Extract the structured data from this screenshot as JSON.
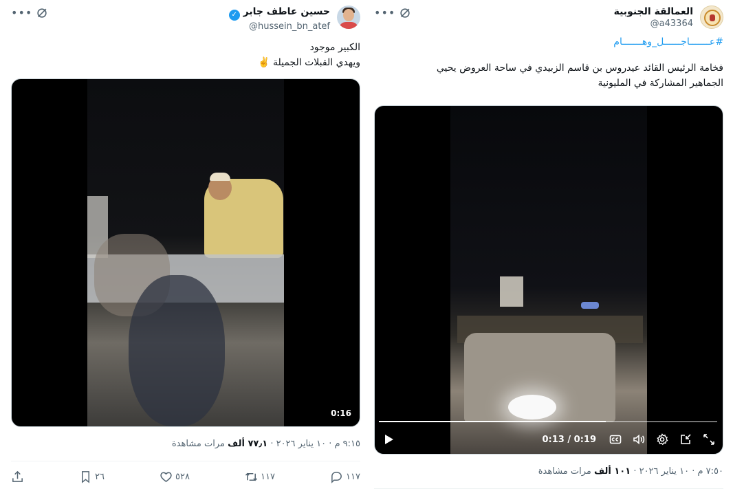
{
  "tweets": [
    {
      "author": {
        "display_name": "حسين عاطف جابر",
        "handle": "@hussein_bn_atef",
        "verified_mark": "✓"
      },
      "text_lines": [
        "الكبير موجود",
        "ويهدي القبلات الجميلة ✌️"
      ],
      "video": {
        "duration_badge": "0:16"
      },
      "meta": {
        "time": "٩:١٥ م",
        "date": "١٠ يناير ٢٠٢٦",
        "sep": "·",
        "views": "٧٧٫١ ألف",
        "views_label": "مرات مشاهدة"
      },
      "actions": {
        "reply": "١١٧",
        "repost": "١١٧",
        "like": "٥٢٨",
        "bookmark": "٢٦"
      }
    },
    {
      "author": {
        "display_name": "العمالقة الجنوبية",
        "handle": "@a43364"
      },
      "hashtag": "#عـــــــاجــــــل_وهـــــــام",
      "text_lines": [
        "فخامة الرئيس القائد عيدروس بن قاسم الزبيدي  في ساحة العروض يحيي",
        "الجماهير المشاركة في المليونية"
      ],
      "video": {
        "time_current": "0:13",
        "time_total": "0:19",
        "time_sep": "/",
        "progress": 0.67
      },
      "meta": {
        "time": "٧:٥٠ م",
        "date": "١٠ يناير ٢٠٢٦",
        "sep": "·",
        "views": "١٠١ ألف",
        "views_label": "مرات مشاهدة"
      }
    }
  ],
  "icons": [
    "more-icon",
    "grok-icon",
    "verified-icon",
    "reply-icon",
    "repost-icon",
    "like-icon",
    "bookmark-icon",
    "share-icon",
    "play-icon",
    "captions-icon",
    "volume-icon",
    "settings-icon",
    "pip-icon",
    "fullscreen-icon"
  ],
  "colors": {
    "accent": "#1d9bf0",
    "secondary_text": "#536471",
    "divider": "#eff3f4"
  }
}
